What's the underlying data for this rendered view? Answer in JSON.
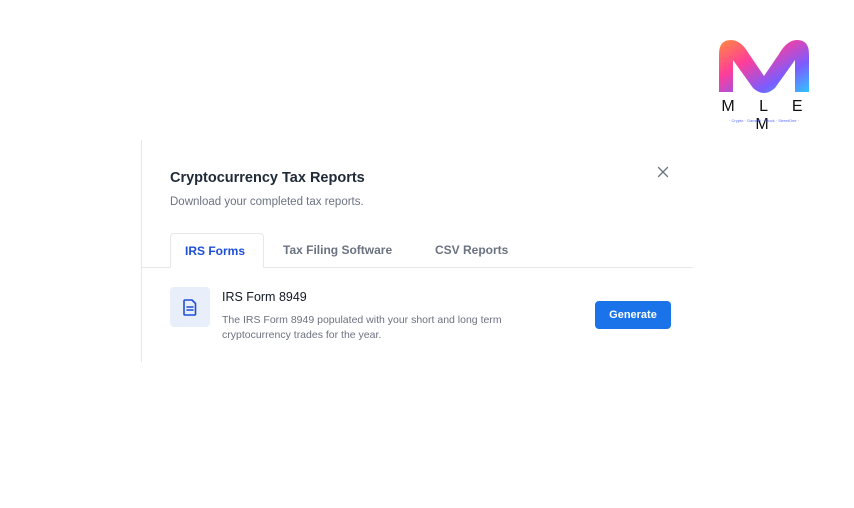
{
  "logo": {
    "wordmark": "M L E M",
    "tagline": "· Crypto · GameFi · Stock · StreetOne ·"
  },
  "modal": {
    "title": "Cryptocurrency Tax Reports",
    "subtitle": "Download your completed tax reports.",
    "close_icon": "close-icon",
    "tabs": [
      {
        "label": "IRS Forms",
        "active": true
      },
      {
        "label": "Tax Filing Software",
        "active": false
      },
      {
        "label": "CSV Reports",
        "active": false
      }
    ],
    "reports": [
      {
        "icon": "document-icon",
        "title": "IRS Form 8949",
        "description": "The IRS Form 8949 populated with your short and long term cryptocurrency trades for the year.",
        "action_label": "Generate"
      }
    ]
  },
  "colors": {
    "accent": "#1a73e8",
    "active_tab": "#1d4ed8",
    "icon_bg": "#e8effb"
  }
}
